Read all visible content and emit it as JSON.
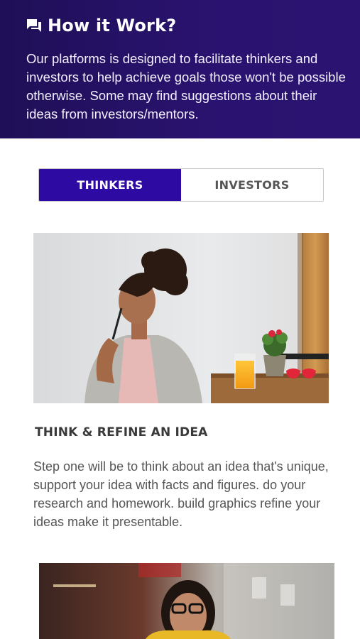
{
  "header": {
    "icon": "chat-bubble-icon",
    "title": "How it Work?",
    "description": "Our platforms is designed to facilitate thinkers and investors to help achieve goals those won't be possible otherwise. Some may find suggestions about their ideas from investors/mentors."
  },
  "tabs": [
    {
      "label": "THINKERS",
      "active": true
    },
    {
      "label": "INVESTORS",
      "active": false
    }
  ],
  "steps": [
    {
      "image": "woman-thinking-photo",
      "title": "THINK & REFINE AN IDEA",
      "text": "Step one will be to think about an idea that's unique, support your idea with facts and figures. do your research and homework. build graphics refine your ideas make it presentable."
    },
    {
      "image": "woman-glasses-photo"
    }
  ],
  "colors": {
    "header_bg": "#24106a",
    "tab_active_bg": "#2d0aa1",
    "tab_inactive_text": "#555555"
  }
}
